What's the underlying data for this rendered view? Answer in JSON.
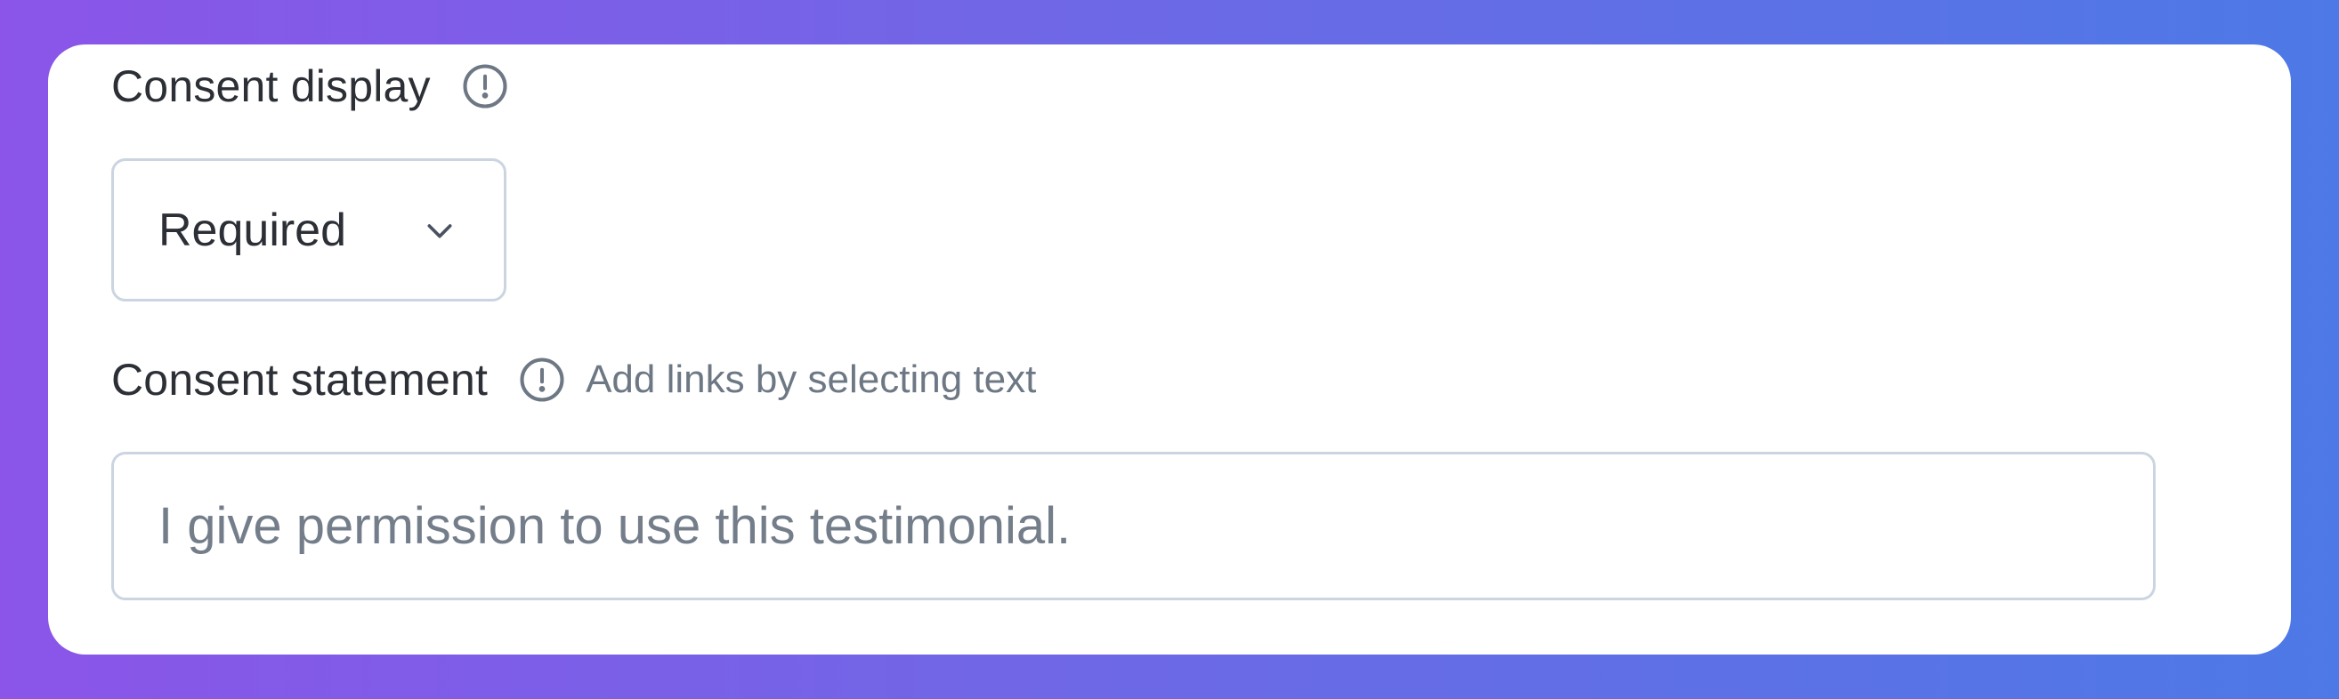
{
  "consent_display": {
    "label": "Consent display",
    "info_icon": "info-circle-icon",
    "select": {
      "value": "Required",
      "icon": "chevron-down-icon"
    }
  },
  "consent_statement": {
    "label": "Consent statement",
    "info_icon": "info-circle-icon",
    "hint": "Add links by selecting text",
    "placeholder": "I give permission to use this testimonial."
  },
  "colors": {
    "background_gradient_start": "#8b55e9",
    "background_gradient_end": "#4d79e6",
    "card": "#ffffff",
    "label_text": "#2c3036",
    "hint_text": "#6d7884",
    "border": "#cbd5e1"
  }
}
